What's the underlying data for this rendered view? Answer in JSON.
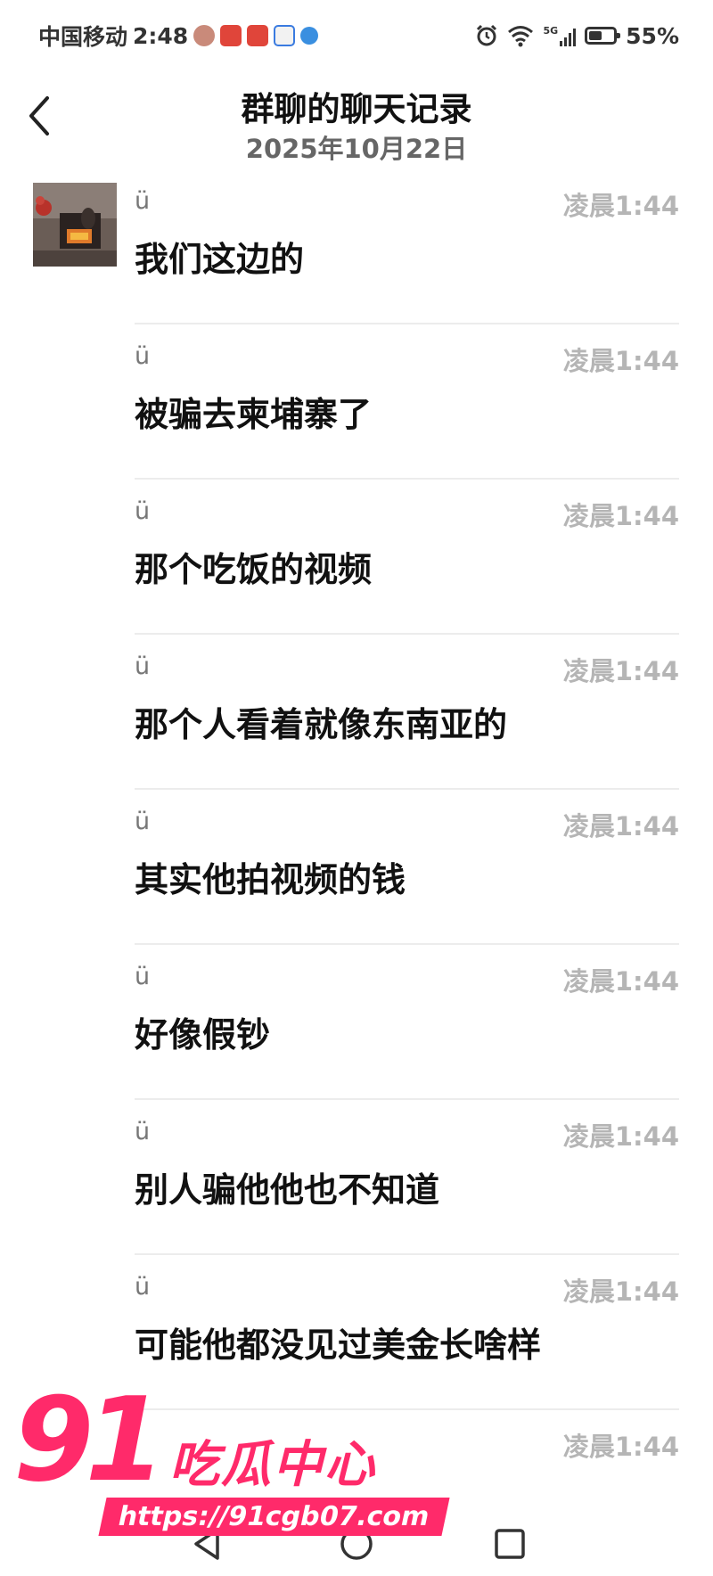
{
  "status_bar": {
    "carrier": "中国移动",
    "time": "2:48",
    "network": "5G",
    "battery": "55%",
    "battery_level": 0.55
  },
  "header": {
    "back_icon": "chevron-left-icon",
    "title": "群聊的聊天记录",
    "date": "2025年10月22日"
  },
  "messages": [
    {
      "sender": "ü",
      "time": "凌晨1:44",
      "text": "我们这边的",
      "has_avatar": true
    },
    {
      "sender": "ü",
      "time": "凌晨1:44",
      "text": "被骗去柬埔寨了"
    },
    {
      "sender": "ü",
      "time": "凌晨1:44",
      "text": "那个吃饭的视频"
    },
    {
      "sender": "ü",
      "time": "凌晨1:44",
      "text": "那个人看着就像东南亚的"
    },
    {
      "sender": "ü",
      "time": "凌晨1:44",
      "text": "其实他拍视频的钱"
    },
    {
      "sender": "ü",
      "time": "凌晨1:44",
      "text": "好像假钞"
    },
    {
      "sender": "ü",
      "time": "凌晨1:44",
      "text": "别人骗他他也不知道"
    },
    {
      "sender": "ü",
      "time": "凌晨1:44",
      "text": "可能他都没见过美金长啥样"
    },
    {
      "sender": "",
      "time": "凌晨1:44",
      "text": ""
    }
  ],
  "watermark": {
    "number": "91",
    "name": "吃瓜中心",
    "url": "https://91cgb07.com",
    "color": "#ff2a6a"
  },
  "nav": {
    "back_icon": "triangle-back-icon",
    "home_icon": "circle-home-icon",
    "recent_icon": "square-recent-icon"
  }
}
